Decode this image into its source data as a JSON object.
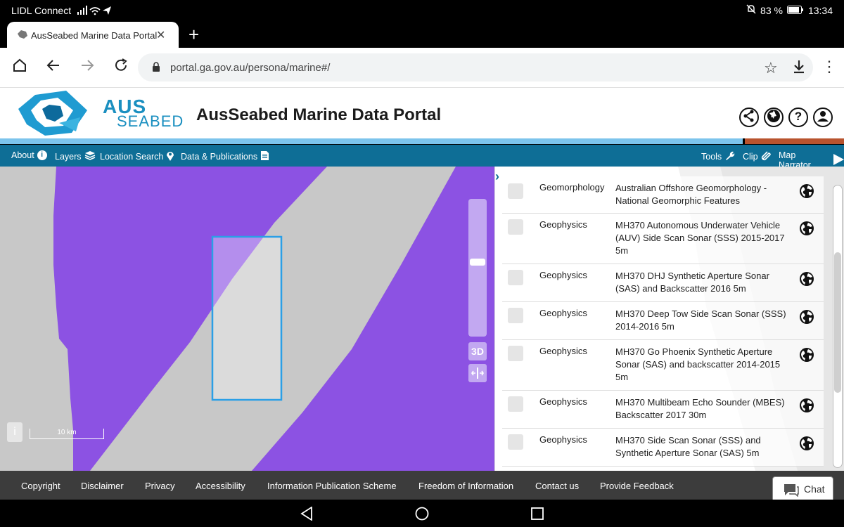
{
  "status": {
    "carrier": "LIDL Connect",
    "battery": "83 %",
    "time": "13:34"
  },
  "browser": {
    "tab_title": "AusSeabed Marine Data Portal",
    "tab_close": "✕",
    "new_tab": "+",
    "url": "portal.ga.gov.au/persona/marine#/"
  },
  "header": {
    "logo_line1": "AUS",
    "logo_line2": "SEABED",
    "title": "AusSeabed Marine Data Portal",
    "icons": [
      "share-icon",
      "aperture-icon",
      "help-icon",
      "user-icon"
    ]
  },
  "navbar": {
    "left": [
      {
        "label": "About",
        "icon": "info-icon"
      },
      {
        "label": "Layers",
        "icon": "layers-icon"
      },
      {
        "label": "Location Search",
        "icon": "pin-icon"
      },
      {
        "label": "Data & Publications",
        "icon": "document-icon"
      }
    ],
    "right": [
      {
        "label": "Tools",
        "icon": "wrench-icon"
      },
      {
        "label": "Clip",
        "icon": "clip-icon"
      },
      {
        "label": "Map Narrator",
        "icon": "play-icon"
      }
    ]
  },
  "map": {
    "btn_3d": "3D",
    "scale_label": "10 km",
    "info_label": "i"
  },
  "layers": [
    {
      "category": "Geomorphology",
      "name": "Australian Offshore Geomorphology - National Geomorphic Features"
    },
    {
      "category": "Geophysics",
      "name": "MH370 Autonomous Underwater Vehicle (AUV) Side Scan Sonar (SSS) 2015-2017 5m"
    },
    {
      "category": "Geophysics",
      "name": "MH370 DHJ Synthetic Aperture Sonar (SAS) and Backscatter 2016 5m"
    },
    {
      "category": "Geophysics",
      "name": "MH370 Deep Tow Side Scan Sonar (SSS) 2014-2016 5m"
    },
    {
      "category": "Geophysics",
      "name": "MH370 Go Phoenix Synthetic Aperture Sonar (SAS) and backscatter 2014-2015 5m"
    },
    {
      "category": "Geophysics",
      "name": "MH370 Multibeam Echo Sounder (MBES) Backscatter 2017 30m"
    },
    {
      "category": "Geophysics",
      "name": "MH370 Side Scan Sonar (SSS) and Synthetic Aperture Sonar (SAS) 5m"
    }
  ],
  "footer": {
    "links": [
      "Copyright",
      "Disclaimer",
      "Privacy",
      "Accessibility",
      "Information Publication Scheme",
      "Freedom of Information",
      "Contact us",
      "Provide Feedback"
    ],
    "chat": "Chat"
  },
  "colors": {
    "purple": "#8c52e3",
    "nav_blue": "#0e6e96",
    "stripe_blue": "#7cc4ec",
    "stripe_rust": "#b8532e",
    "footer": "#3c3c3c"
  }
}
